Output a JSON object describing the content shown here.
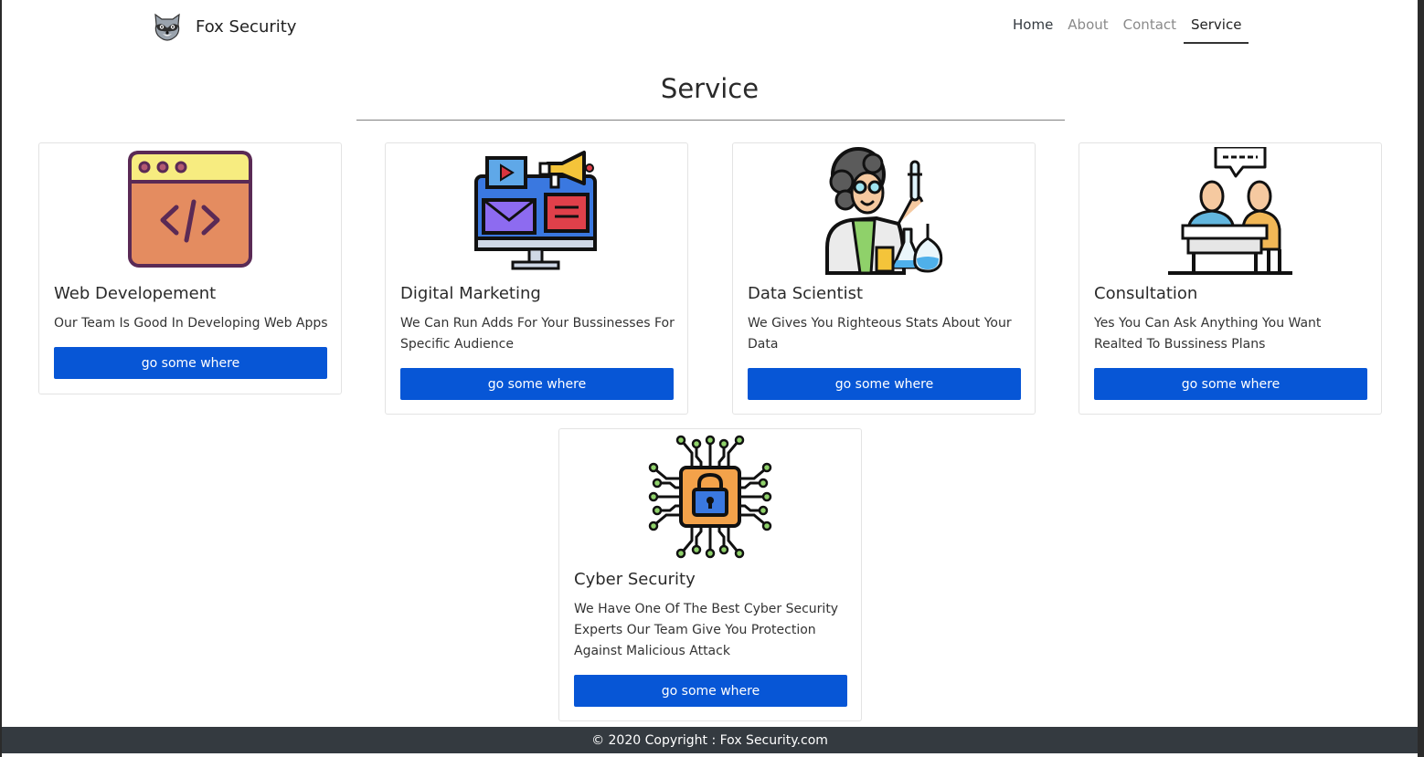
{
  "brand": {
    "name": "Fox Security",
    "logo_icon": "raccoon-icon"
  },
  "nav": {
    "items": [
      "Home",
      "About",
      "Contact",
      "Service"
    ],
    "active": "Service"
  },
  "page": {
    "title": "Service"
  },
  "cards": [
    {
      "title": "Web Developement",
      "text": "Our Team Is Good In Developing Web Apps",
      "button": "go some where",
      "icon": "code-window-icon"
    },
    {
      "title": "Digital Marketing",
      "text": "We Can Run Adds For Your Bussinesses For Specific Audience",
      "button": "go some where",
      "icon": "marketing-monitor-icon"
    },
    {
      "title": "Data Scientist",
      "text": "We Gives You Righteous Stats About Your Data",
      "button": "go some where",
      "icon": "scientist-icon"
    },
    {
      "title": "Consultation",
      "text": "Yes You Can Ask Anything You Want Realted To Bussiness Plans",
      "button": "go some where",
      "icon": "consultation-icon"
    },
    {
      "title": "Cyber Security",
      "text": "We Have One Of The Best Cyber Security Experts Our Team Give You Protection Against Malicious Attack",
      "button": "go some where",
      "icon": "circuit-lock-icon"
    }
  ],
  "footer": {
    "text": "© 2020 Copyright : Fox Security.com"
  },
  "colors": {
    "button": "#0756d6",
    "footer": "#343a40"
  }
}
